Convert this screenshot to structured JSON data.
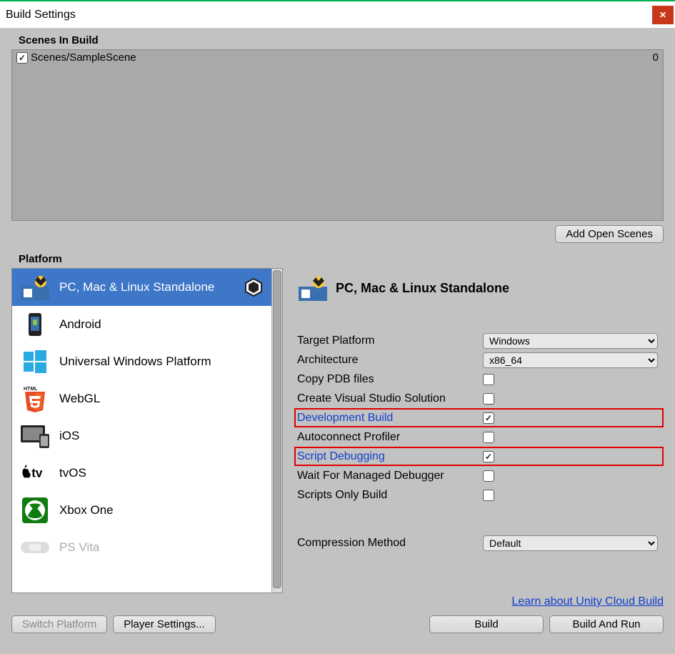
{
  "window": {
    "title": "Build Settings"
  },
  "scenes": {
    "heading": "Scenes In Build",
    "items": [
      {
        "name": "Scenes/SampleScene",
        "checked": true,
        "index": "0"
      }
    ],
    "add_button": "Add Open Scenes"
  },
  "platform": {
    "heading": "Platform",
    "items": [
      {
        "label": "PC, Mac & Linux Standalone",
        "selected": true
      },
      {
        "label": "Android"
      },
      {
        "label": "Universal Windows Platform"
      },
      {
        "label": "WebGL"
      },
      {
        "label": "iOS"
      },
      {
        "label": "tvOS"
      },
      {
        "label": "Xbox One"
      },
      {
        "label": "PS Vita"
      }
    ]
  },
  "settings": {
    "title": "PC, Mac & Linux Standalone",
    "target_platform": {
      "label": "Target Platform",
      "value": "Windows"
    },
    "architecture": {
      "label": "Architecture",
      "value": "x86_64"
    },
    "copy_pdb": {
      "label": "Copy PDB files",
      "checked": false
    },
    "create_vs": {
      "label": "Create Visual Studio Solution",
      "checked": false
    },
    "dev_build": {
      "label": "Development Build",
      "checked": true,
      "highlight": true
    },
    "autoconnect": {
      "label": "Autoconnect Profiler",
      "checked": false
    },
    "script_debug": {
      "label": "Script Debugging",
      "checked": true,
      "highlight": true
    },
    "wait_debugger": {
      "label": "Wait For Managed Debugger",
      "checked": false
    },
    "scripts_only": {
      "label": "Scripts Only Build",
      "checked": false
    },
    "compression": {
      "label": "Compression Method",
      "value": "Default"
    },
    "cloud_link": "Learn about Unity Cloud Build"
  },
  "buttons": {
    "switch_platform": "Switch Platform",
    "player_settings": "Player Settings...",
    "build": "Build",
    "build_and_run": "Build And Run"
  }
}
